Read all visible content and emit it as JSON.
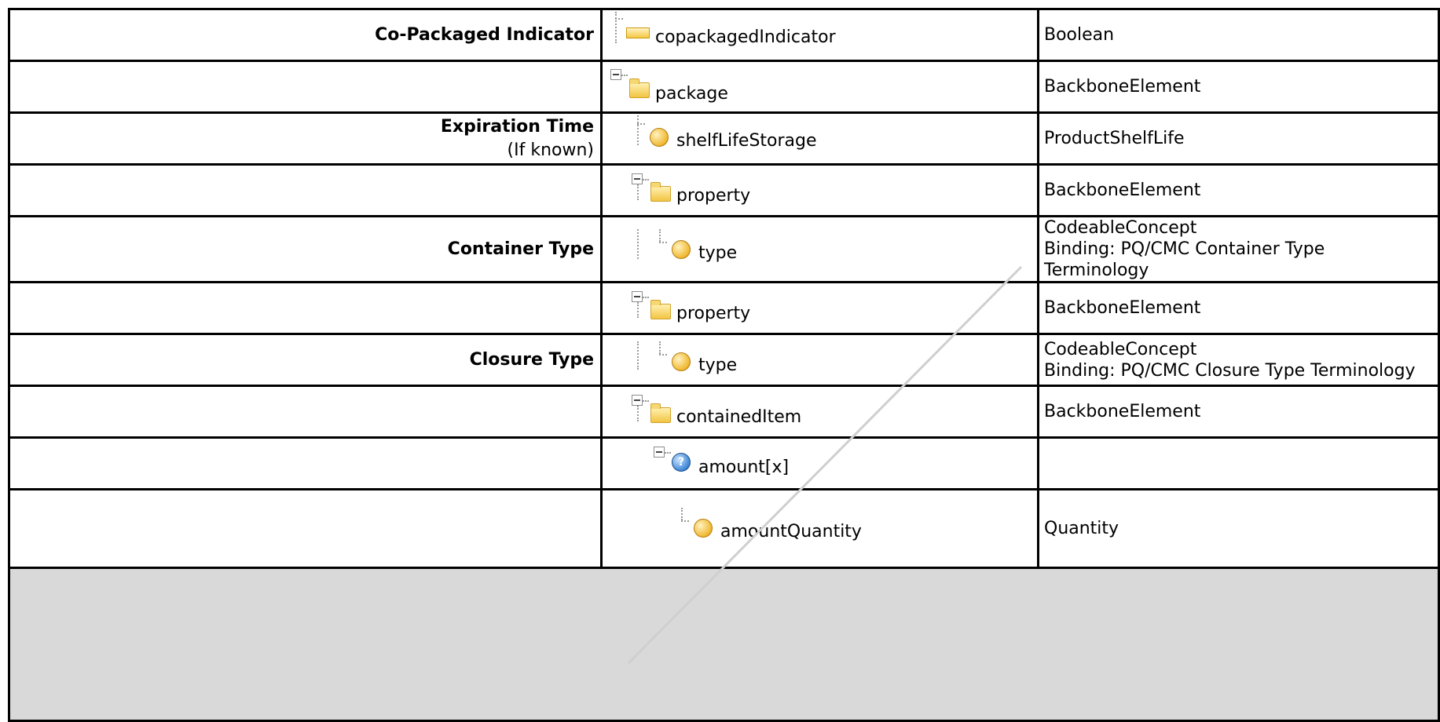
{
  "rows": [
    {
      "label": "Co-Packaged Indicator",
      "sublabel": "",
      "element": "copackagedIndicator",
      "type_lines": [
        "Boolean"
      ]
    },
    {
      "label": "",
      "sublabel": "",
      "element": "package",
      "type_lines": [
        "BackboneElement"
      ]
    },
    {
      "label": "Expiration Time",
      "sublabel": "(If known)",
      "element": "shelfLifeStorage",
      "type_lines": [
        "ProductShelfLife"
      ]
    },
    {
      "label": "",
      "sublabel": "",
      "element": "property",
      "type_lines": [
        "BackboneElement"
      ]
    },
    {
      "label": "Container Type",
      "sublabel": "",
      "element": "type",
      "type_lines": [
        "CodeableConcept",
        "Binding: PQ/CMC Container Type",
        "Terminology"
      ]
    },
    {
      "label": "",
      "sublabel": "",
      "element": "property",
      "type_lines": [
        "BackboneElement"
      ]
    },
    {
      "label": "Closure Type",
      "sublabel": "",
      "element": "type",
      "type_lines": [
        "CodeableConcept",
        "Binding: PQ/CMC Closure Type Terminology"
      ]
    },
    {
      "label": "",
      "sublabel": "",
      "element": "containedItem",
      "type_lines": [
        "BackboneElement"
      ]
    },
    {
      "label": "",
      "sublabel": "",
      "element": "amount[x]",
      "type_lines": [
        ""
      ]
    },
    {
      "label": "",
      "sublabel": "",
      "element": "amountQuantity",
      "type_lines": [
        "Quantity"
      ]
    }
  ],
  "icons": {
    "choice_glyph": "?"
  }
}
